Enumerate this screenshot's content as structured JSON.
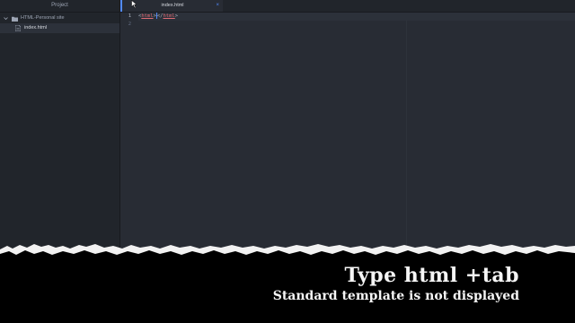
{
  "sidebar": {
    "header": "Project",
    "project_name": "HTML-Personal site",
    "files": [
      "index.html"
    ]
  },
  "editor": {
    "tab_title": "index.html",
    "tab_close": "×",
    "line_numbers": [
      "1",
      "2"
    ],
    "code": {
      "open_lt": "<",
      "open_tag": "html",
      "open_gt": ">",
      "close_lt": "</",
      "close_tag": "html",
      "close_gt": ">"
    }
  },
  "caption": {
    "title": "Type html +tab",
    "subtitle": "Standard template is not displayed"
  },
  "colors": {
    "background": "#21252b",
    "editor_background": "#282c34",
    "accent": "#528bff",
    "tag": "#e06c75",
    "caption_text": "#f5f5f5"
  },
  "icons": {
    "folder": "folder-icon",
    "file": "file-icon",
    "chevron": "chevron-down-icon"
  }
}
